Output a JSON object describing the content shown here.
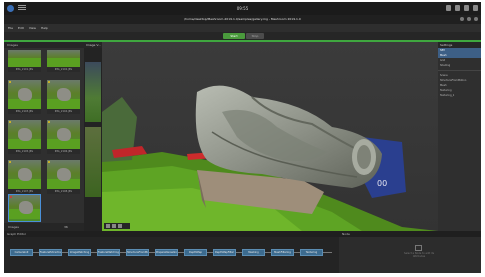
{
  "os": {
    "clock": "09:55"
  },
  "window": {
    "title": "/home/desktop/Meshroom-2019.1.0/samples/gallery.mg - Meshroom 2019.1.0"
  },
  "menu": [
    "File",
    "Edit",
    "View",
    "Help"
  ],
  "toolbar": {
    "start": "Start",
    "stop": "Stop"
  },
  "images_panel": {
    "title": "Images",
    "thumbnails": [
      {
        "caption": "IMG_2101.JPG"
      },
      {
        "caption": "IMG_2102.JPG"
      },
      {
        "caption": "IMG_2103.JPG"
      },
      {
        "caption": "IMG_2104.JPG"
      },
      {
        "caption": "IMG_2105.JPG"
      },
      {
        "caption": "IMG_2106.JPG"
      },
      {
        "caption": "IMG_2107.JPG"
      },
      {
        "caption": "IMG_2108.JPG"
      },
      {
        "caption": "IMG_2109.JPG"
      }
    ],
    "footer_count": "36",
    "footer_label": "Images"
  },
  "viewer_tabs": [
    "Image V...",
    "3D Viewer"
  ],
  "right_panel": {
    "title": "Settings",
    "rows": [
      "SfM",
      "Mesh",
      "Grid",
      "Shading",
      "Scene",
      "StructureFromMotion",
      "Mesh",
      "Texturing",
      "Texturing_1"
    ]
  },
  "graph": {
    "title": "Graph Editor",
    "nodes": [
      "CameraInit",
      "FeatureExtraction",
      "ImageMatching",
      "FeatureMatching",
      "StructureFromMotion",
      "PrepareDenseScene",
      "DepthMap",
      "DepthMapFilter",
      "Meshing",
      "MeshFiltering",
      "Texturing"
    ]
  },
  "node_attributes": {
    "title": "Node",
    "hint": "Select a Node to edit its Attributes"
  }
}
